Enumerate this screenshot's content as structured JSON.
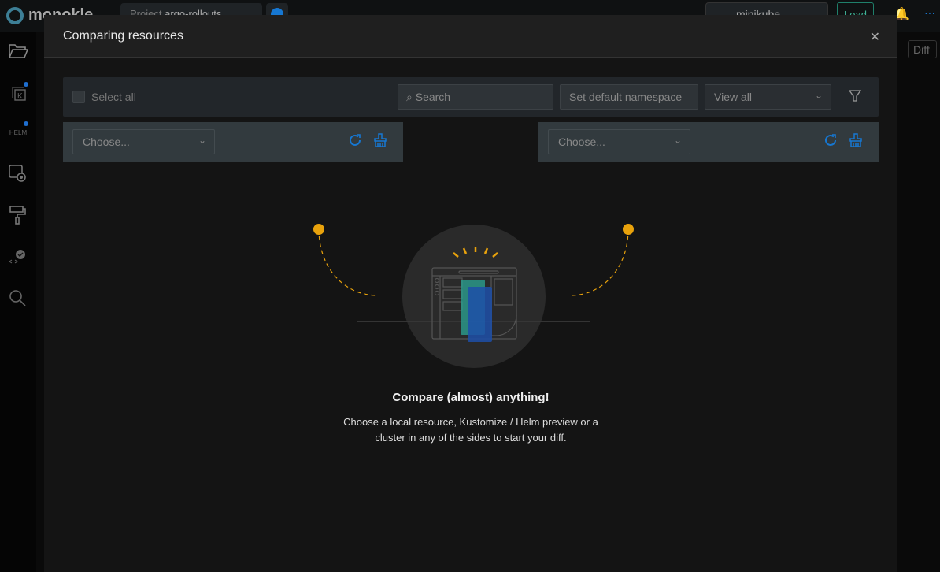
{
  "app": {
    "logo_text": "monokle",
    "project_label": "Project",
    "project_name": "argo-rollouts",
    "cluster": "minikube",
    "load_label": "Load",
    "diff_label": "Diff"
  },
  "sidebar": {
    "items": [
      {
        "icon": "folder-icon"
      },
      {
        "icon": "kustomize-icon",
        "badge": true
      },
      {
        "icon": "helm-icon",
        "badge": true
      },
      {
        "icon": "preview-icon"
      },
      {
        "icon": "templates-icon"
      },
      {
        "icon": "validation-icon"
      },
      {
        "icon": "search-icon"
      }
    ]
  },
  "modal": {
    "title": "Comparing resources",
    "toolbar": {
      "select_all": "Select all",
      "search_placeholder": "Search",
      "set_namespace": "Set default namespace",
      "view_select": "View all"
    },
    "left": {
      "placeholder": "Choose..."
    },
    "right": {
      "placeholder": "Choose..."
    },
    "empty": {
      "title": "Compare (almost) anything!",
      "line1": "Choose a local resource, Kustomize / Helm preview or a",
      "line2": "cluster in any of the sides to start your diff."
    }
  },
  "colors": {
    "accent": "#1677d2",
    "highlight": "#e8a20c",
    "teal": "#2a9d8f"
  }
}
